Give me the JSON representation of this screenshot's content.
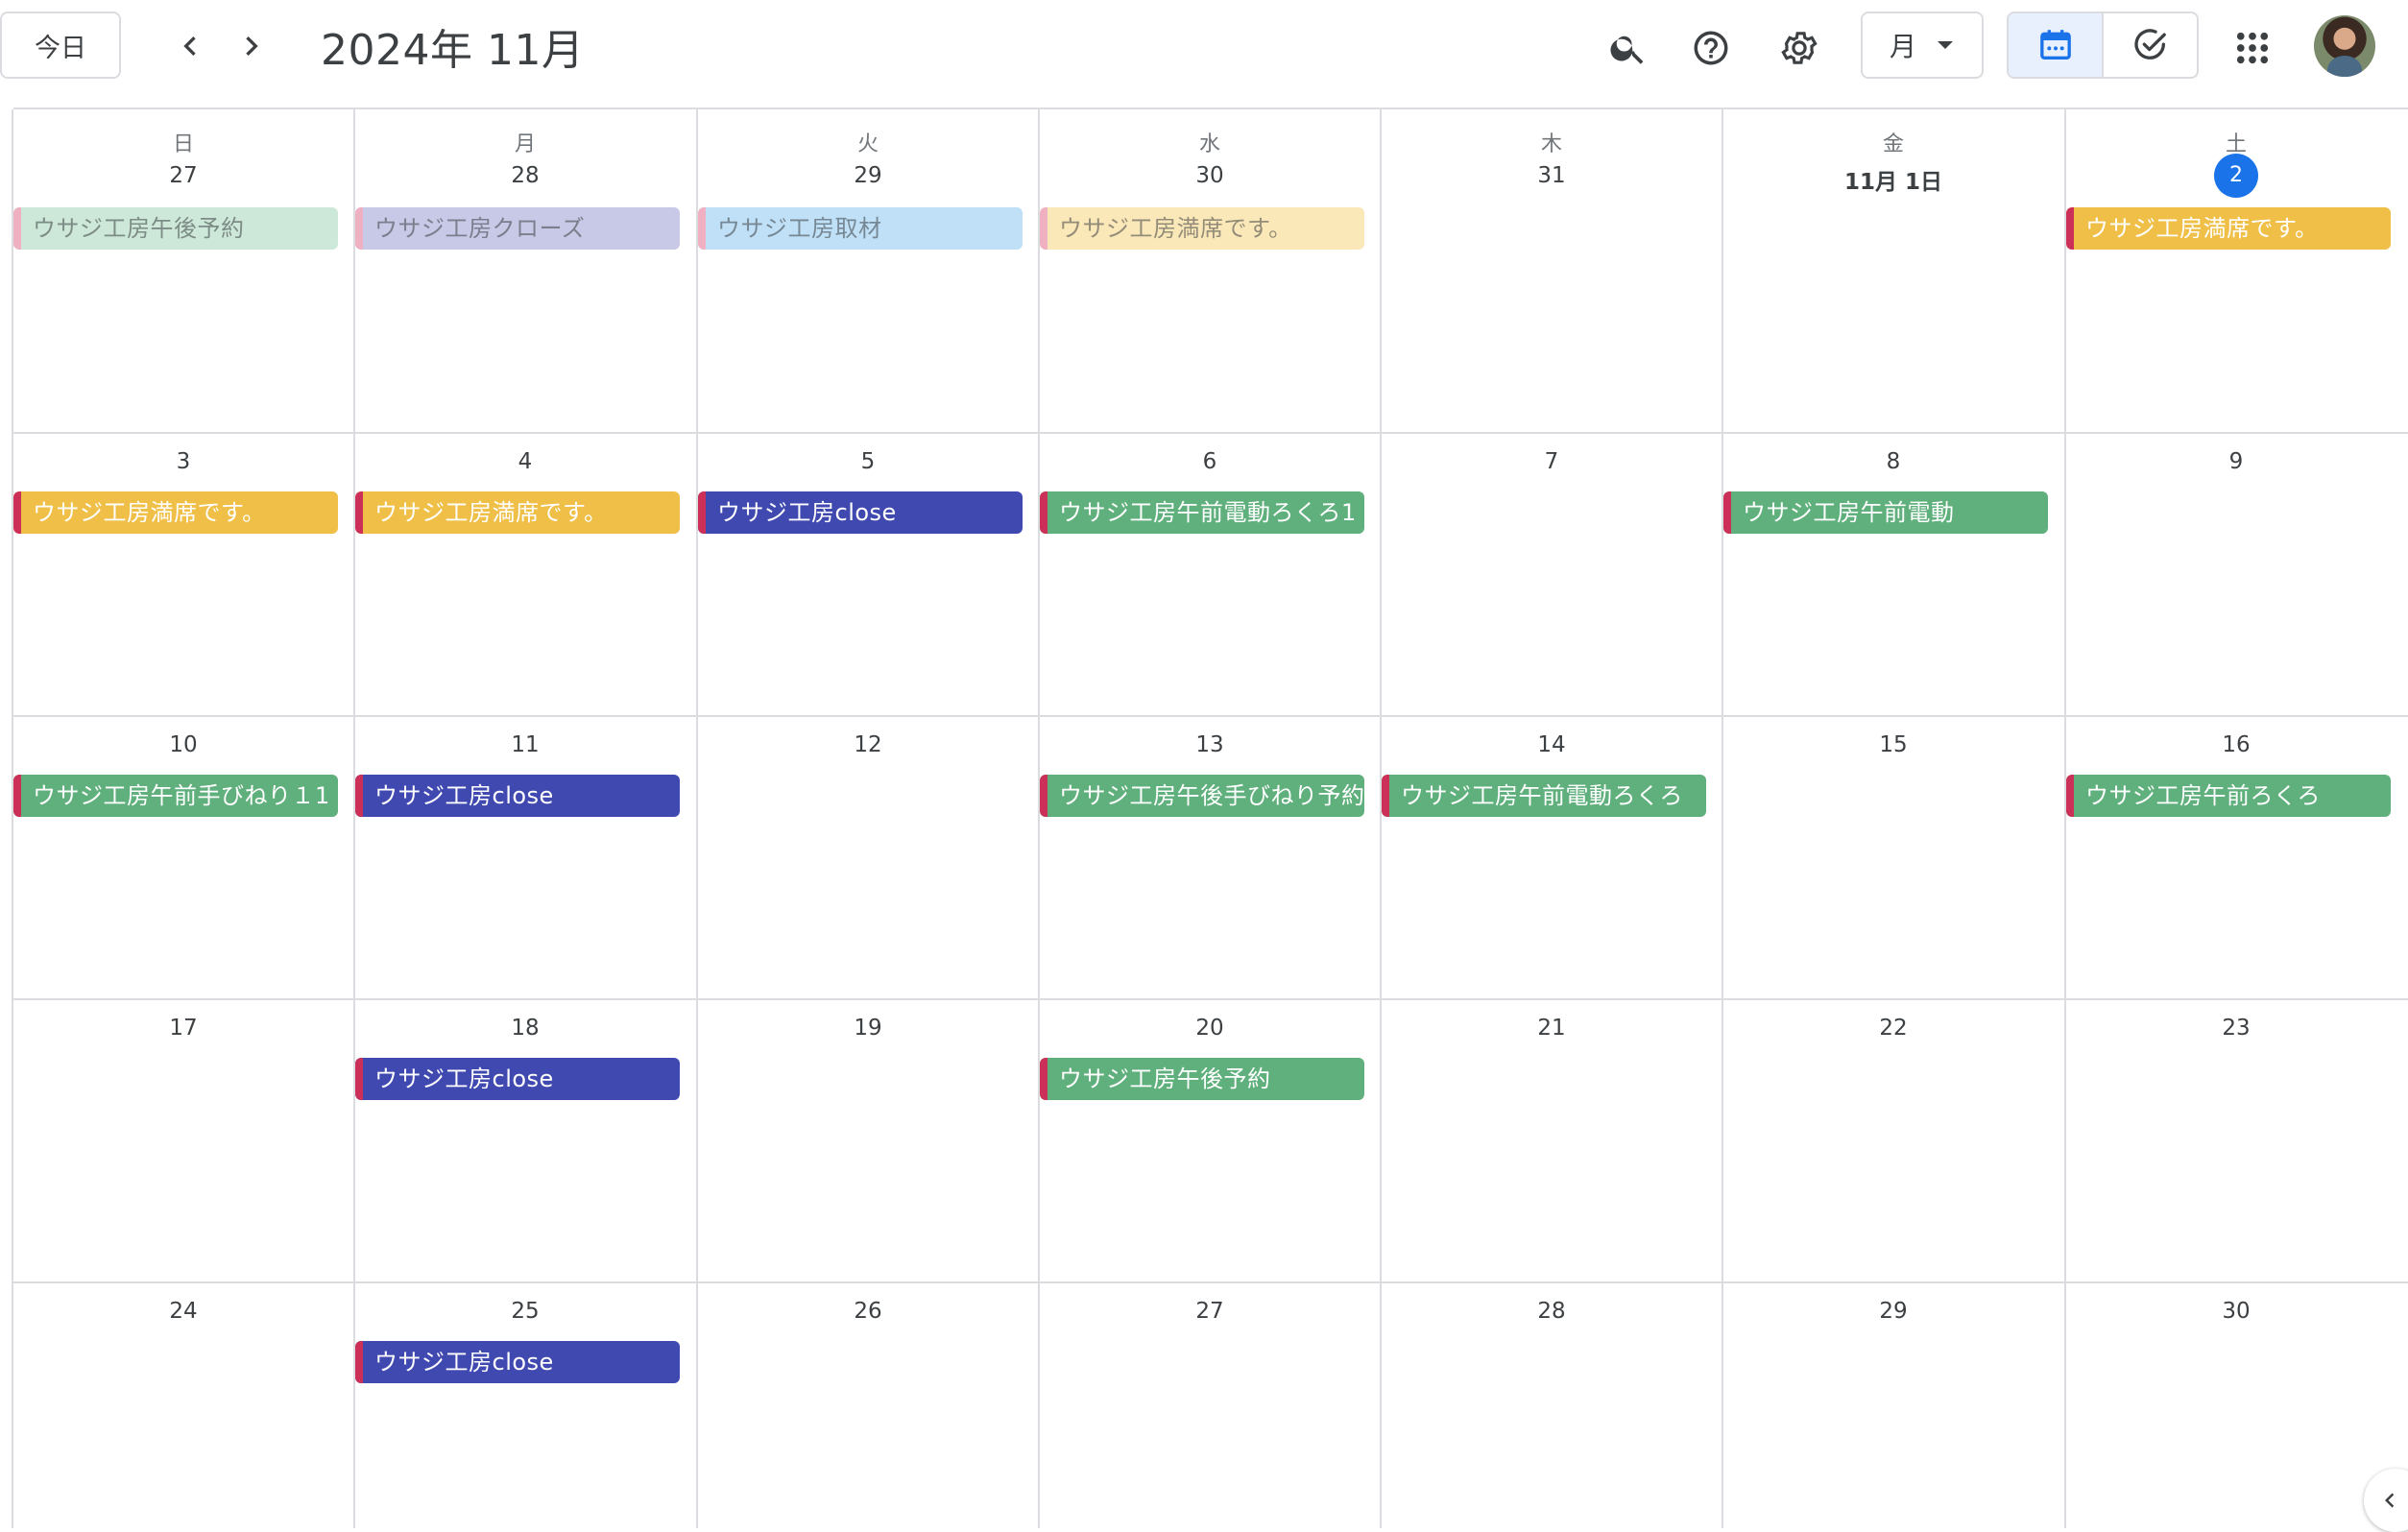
{
  "toolbar": {
    "today_label": "今日",
    "title": "2024年 11月",
    "view_label": "月",
    "icons": [
      "search-icon",
      "help-icon",
      "settings-icon",
      "calendar-icon",
      "tasks-check-icon",
      "apps-grid-icon",
      "chevron-left-icon",
      "chevron-right-icon"
    ]
  },
  "colors": {
    "green": "#5fb07c",
    "yellow": "#efbf48",
    "indigo": "#4049b0",
    "lavender": "#c7c9e6",
    "lightblue": "#bfe0f6",
    "lightgreen": "#cde8d8",
    "lightyellow": "#fbe8b8",
    "bar_red": "#cc2f58",
    "bar_pink": "#efb1c2",
    "today": "#1a73e8"
  },
  "calendar": {
    "weekdays": [
      "日",
      "月",
      "火",
      "水",
      "木",
      "金",
      "土"
    ],
    "weeks": [
      {
        "days": [
          "27",
          "28",
          "29",
          "30",
          "31",
          "11月 1日",
          "2"
        ]
      },
      {
        "days": [
          "3",
          "4",
          "5",
          "6",
          "7",
          "8",
          "9"
        ]
      },
      {
        "days": [
          "10",
          "11",
          "12",
          "13",
          "14",
          "15",
          "16"
        ]
      },
      {
        "days": [
          "17",
          "18",
          "19",
          "20",
          "21",
          "22",
          "23"
        ]
      },
      {
        "days": [
          "24",
          "25",
          "26",
          "27",
          "28",
          "29",
          "30"
        ]
      }
    ],
    "today": {
      "week": 0,
      "col": 6
    },
    "bold_day": {
      "week": 0,
      "col": 5
    },
    "events": [
      {
        "week": 0,
        "col": 0,
        "title": "ウサジ工房午後予約",
        "color": "lightgreen",
        "bar": "bar_pink",
        "past": true
      },
      {
        "week": 0,
        "col": 1,
        "title": "ウサジ工房クローズ",
        "color": "lavender",
        "bar": "bar_pink",
        "past": true
      },
      {
        "week": 0,
        "col": 2,
        "title": "ウサジ工房取材",
        "color": "lightblue",
        "bar": "bar_pink",
        "past": true
      },
      {
        "week": 0,
        "col": 3,
        "title": "ウサジ工房満席です。",
        "color": "lightyellow",
        "bar": "bar_pink",
        "past": true
      },
      {
        "week": 0,
        "col": 6,
        "title": "ウサジ工房満席です。",
        "color": "yellow",
        "bar": "bar_red",
        "past": false
      },
      {
        "week": 1,
        "col": 0,
        "title": "ウサジ工房満席です。",
        "color": "yellow",
        "bar": "bar_red",
        "past": false
      },
      {
        "week": 1,
        "col": 1,
        "title": "ウサジ工房満席です。",
        "color": "yellow",
        "bar": "bar_red",
        "past": false
      },
      {
        "week": 1,
        "col": 2,
        "title": "ウサジ工房close",
        "color": "indigo",
        "bar": "bar_red",
        "past": false
      },
      {
        "week": 1,
        "col": 3,
        "title": "ウサジ工房午前電動ろくろ1",
        "color": "green",
        "bar": "bar_red",
        "past": false
      },
      {
        "week": 1,
        "col": 5,
        "title": "ウサジ工房午前電動",
        "color": "green",
        "bar": "bar_red",
        "past": false
      },
      {
        "week": 2,
        "col": 0,
        "title": "ウサジ工房午前手びねり１1",
        "color": "green",
        "bar": "bar_red",
        "past": false
      },
      {
        "week": 2,
        "col": 1,
        "title": "ウサジ工房close",
        "color": "indigo",
        "bar": "bar_red",
        "past": false
      },
      {
        "week": 2,
        "col": 3,
        "title": "ウサジ工房午後手びねり予約",
        "color": "green",
        "bar": "bar_red",
        "past": false
      },
      {
        "week": 2,
        "col": 4,
        "title": "ウサジ工房午前電動ろくろ",
        "color": "green",
        "bar": "bar_red",
        "past": false
      },
      {
        "week": 2,
        "col": 6,
        "title": "ウサジ工房午前ろくろ",
        "color": "green",
        "bar": "bar_red",
        "past": false
      },
      {
        "week": 3,
        "col": 1,
        "title": "ウサジ工房close",
        "color": "indigo",
        "bar": "bar_red",
        "past": false
      },
      {
        "week": 3,
        "col": 3,
        "title": "ウサジ工房午後予約",
        "color": "green",
        "bar": "bar_red",
        "past": false
      },
      {
        "week": 4,
        "col": 1,
        "title": "ウサジ工房close",
        "color": "indigo",
        "bar": "bar_red",
        "past": false
      }
    ]
  }
}
